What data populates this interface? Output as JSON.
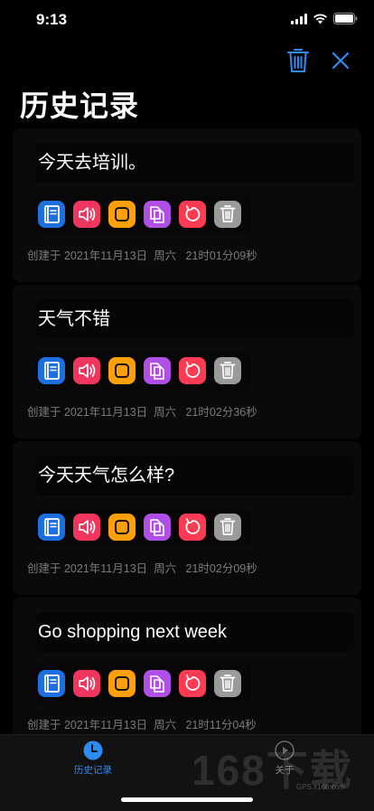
{
  "status_bar": {
    "time": "9:13"
  },
  "header": {
    "title": "历史记录"
  },
  "colors": {
    "accent": "#2d8cf0",
    "book": "#1d6fe0",
    "speaker": "#f0365f",
    "square": "#ff9f0a",
    "copy": "#b04fe6",
    "undo": "#ff3b54",
    "trash": "#9a9a9a"
  },
  "records": [
    {
      "text": "今天去培训。",
      "date": "创建于 2021年11月13日  周六   21时01分09秒"
    },
    {
      "text": "天气不错",
      "date": "创建于 2021年11月13日  周六   21时02分36秒"
    },
    {
      "text": "今天天气怎么样?",
      "date": "创建于 2021年11月13日  周六   21时02分09秒"
    },
    {
      "text": "Go shopping next week",
      "date": "创建于 2021年11月13日  周六   21时11分04秒"
    }
  ],
  "tab_bar": {
    "history_label": "历史记录",
    "about_label": "关于"
  },
  "watermark": {
    "logo": "168下载",
    "site": "GPS.it168.com"
  }
}
